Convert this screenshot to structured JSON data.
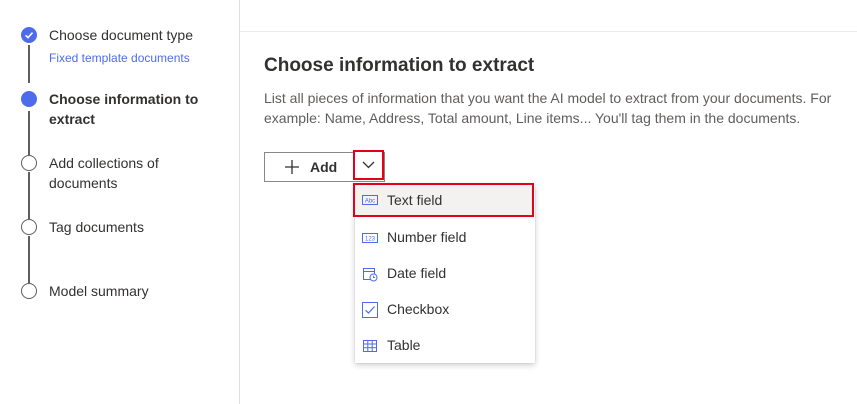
{
  "steps": [
    {
      "label": "Choose document type",
      "sub": "Fixed template documents",
      "state": "done"
    },
    {
      "label_line1": "Choose information to",
      "label_line2": "extract",
      "state": "current"
    },
    {
      "label_line1": "Add collections of",
      "label_line2": "documents",
      "state": "todo"
    },
    {
      "label": "Tag documents",
      "state": "todo"
    },
    {
      "label": "Model summary",
      "state": "todo"
    }
  ],
  "main": {
    "title": "Choose information to extract",
    "description": "List all pieces of information that you want the AI model to extract from your documents. For example: Name, Address, Total amount, Line items... You'll tag them in the documents.",
    "add_button_label": "Add"
  },
  "menu": {
    "items": [
      {
        "label": "Text field",
        "icon": "text-field-icon"
      },
      {
        "label": "Number field",
        "icon": "number-field-icon"
      },
      {
        "label": "Date field",
        "icon": "calendar-clock-icon"
      },
      {
        "label": "Checkbox",
        "icon": "checkbox-icon"
      },
      {
        "label": "Table",
        "icon": "table-icon"
      }
    ]
  },
  "colors": {
    "accent": "#4f6bed",
    "highlight": "#e3001b"
  }
}
